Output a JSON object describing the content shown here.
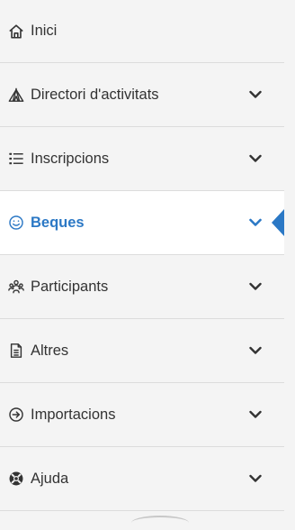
{
  "sidebar": {
    "items": [
      {
        "label": "Inici",
        "icon": "home-icon",
        "has_chevron": false
      },
      {
        "label": "Directori d'activitats",
        "icon": "tent-icon",
        "has_chevron": true
      },
      {
        "label": "Inscripcions",
        "icon": "list-icon",
        "has_chevron": true
      },
      {
        "label": "Beques",
        "icon": "smile-icon",
        "has_chevron": true,
        "active": true
      },
      {
        "label": "Participants",
        "icon": "users-icon",
        "has_chevron": true
      },
      {
        "label": "Altres",
        "icon": "file-icon",
        "has_chevron": true
      },
      {
        "label": "Importacions",
        "icon": "circle-arrow-right-icon",
        "has_chevron": true
      },
      {
        "label": "Ajuda",
        "icon": "lifebuoy-icon",
        "has_chevron": true
      }
    ]
  },
  "colors": {
    "active_text": "#2b78c5",
    "text": "#333333",
    "background": "#f4f4f4",
    "active_background": "#ffffff"
  }
}
